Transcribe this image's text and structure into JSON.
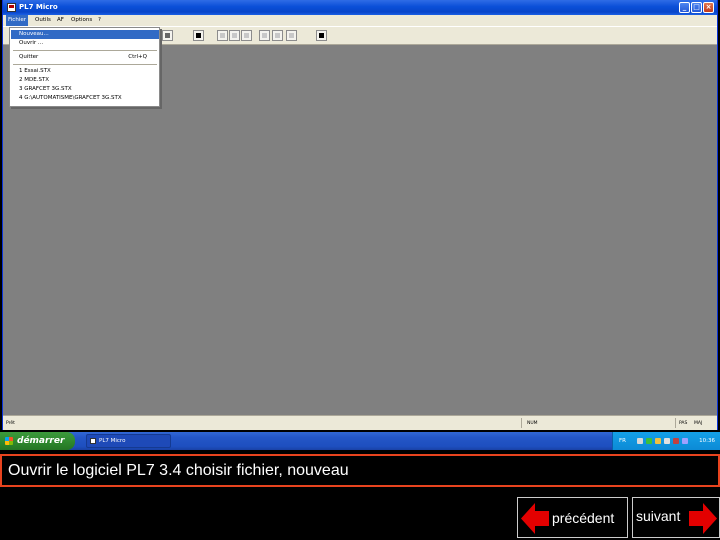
{
  "window": {
    "title": "PL7 Micro",
    "controls": [
      "minimize",
      "maximize",
      "close"
    ]
  },
  "menubar": {
    "items": [
      {
        "label": "Fichier",
        "active": true
      },
      {
        "label": "Outils"
      },
      {
        "label": "AF"
      },
      {
        "label": "Options"
      },
      {
        "label": "?"
      }
    ]
  },
  "dropdown": {
    "items": [
      {
        "label": "Nouveau...",
        "highlighted": true
      },
      {
        "label": "Ouvrir ..."
      },
      {
        "label": "Quitter",
        "shortcut": "Ctrl+Q"
      },
      {
        "label": "1 Essai.STX"
      },
      {
        "label": "2 MDE.STX"
      },
      {
        "label": "3 GRAFCET 3G.STX"
      },
      {
        "label": "4 G:\\AUTOMATISME\\GRAFCET 3G.STX"
      }
    ]
  },
  "toolbar": {
    "icons": [
      "network-icon",
      "book-icon",
      "list-icon",
      "tree-icon",
      "grid-icon",
      "print-icon",
      "window-icon",
      "window2-icon",
      "help-cursor-icon"
    ]
  },
  "statusbar": {
    "ready": "Prêt",
    "middle": "NUM",
    "right1": "PAS",
    "right2": "MAJ"
  },
  "taskbar": {
    "start": "démarrer",
    "task": "PL7 Micro",
    "lang": "FR",
    "time": "10:36"
  },
  "colors": {
    "workspace": "#808080",
    "caption_border": "#e8431e",
    "arrow": "#e30000"
  },
  "caption": {
    "text": "Ouvrir le logiciel PL7 3.4 choisir fichier, nouveau"
  },
  "nav": {
    "prev": "précédent",
    "next": "suivant"
  }
}
